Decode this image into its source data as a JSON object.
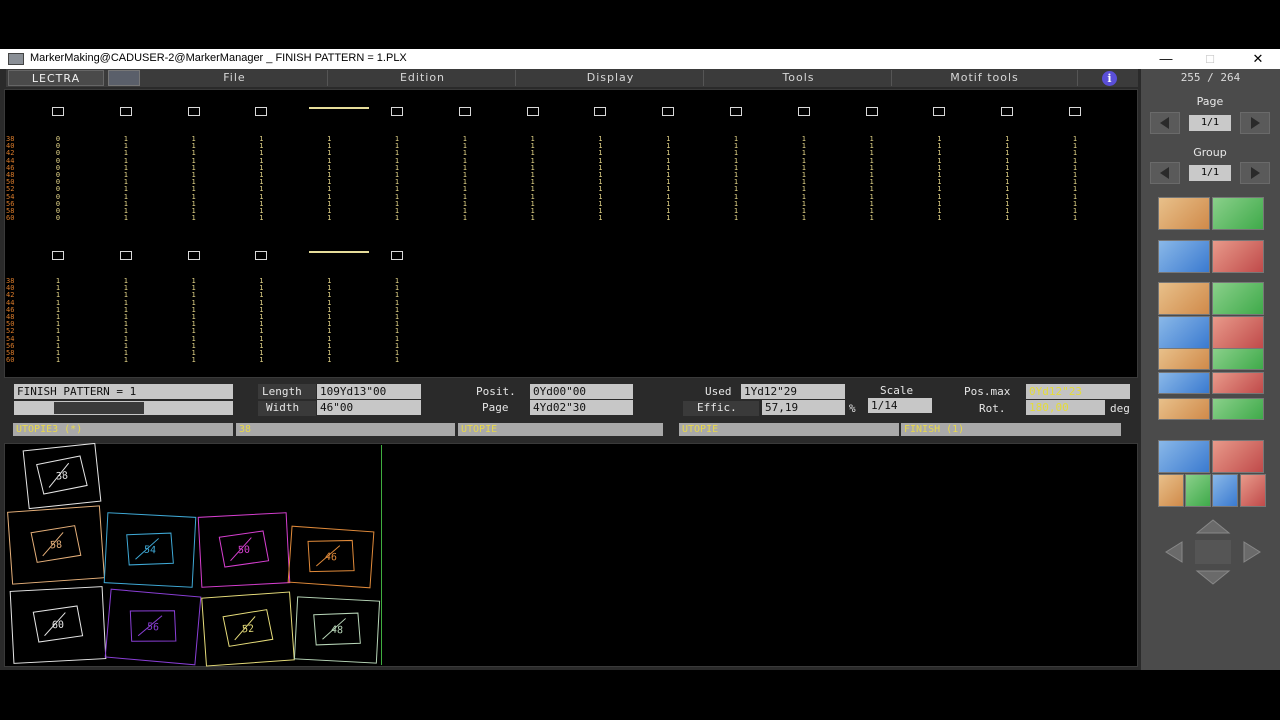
{
  "window": {
    "title": "MarkerMaking@CADUSER-2@MarkerManager _ FINISH PATTERN =  1.PLX",
    "minimize": "—",
    "maximize": "□",
    "close": "✕"
  },
  "menubar": {
    "logo": "LECTRA",
    "items": [
      "File",
      "Edition",
      "Display",
      "Tools",
      "Motif tools"
    ],
    "info": "i"
  },
  "right_panel": {
    "counter": "255 / 264",
    "page_label": "Page",
    "page_value": "1/1",
    "group_label": "Group",
    "group_value": "1/1",
    "tools": [
      "move-up-icon",
      "flip-icon",
      "place-icon",
      "combine-icon",
      "rotate-icon",
      "overlap-icon",
      "zoom-icon",
      "cut-icon",
      "block-icon",
      "band-icon",
      "stripe-icon",
      "piece-icon",
      "swap-icon",
      "marker-icon",
      "split-icon",
      "tile-icon",
      "draw-icon",
      "buffer-icon",
      "sort-icon",
      "group-icon"
    ]
  },
  "table": {
    "sizes": [
      "38",
      "40",
      "42",
      "44",
      "46",
      "48",
      "50",
      "52",
      "54",
      "56",
      "58",
      "60"
    ],
    "row1_columns": [
      [
        "0",
        "0",
        "0",
        "0",
        "0",
        "0",
        "0",
        "0",
        "0",
        "0",
        "0",
        "0"
      ],
      [
        "1",
        "1",
        "1",
        "1",
        "1",
        "1",
        "1",
        "1",
        "1",
        "1",
        "1",
        "1"
      ],
      [
        "1",
        "1",
        "1",
        "1",
        "1",
        "1",
        "1",
        "1",
        "1",
        "1",
        "1",
        "1"
      ],
      [
        "1",
        "1",
        "1",
        "1",
        "1",
        "1",
        "1",
        "1",
        "1",
        "1",
        "1",
        "1"
      ],
      [
        "1",
        "1",
        "1",
        "1",
        "1",
        "1",
        "1",
        "1",
        "1",
        "1",
        "1",
        "1"
      ],
      [
        "1",
        "1",
        "1",
        "1",
        "1",
        "1",
        "1",
        "1",
        "1",
        "1",
        "1",
        "1"
      ],
      [
        "1",
        "1",
        "1",
        "1",
        "1",
        "1",
        "1",
        "1",
        "1",
        "1",
        "1",
        "1"
      ],
      [
        "1",
        "1",
        "1",
        "1",
        "1",
        "1",
        "1",
        "1",
        "1",
        "1",
        "1",
        "1"
      ],
      [
        "1",
        "1",
        "1",
        "1",
        "1",
        "1",
        "1",
        "1",
        "1",
        "1",
        "1",
        "1"
      ],
      [
        "1",
        "1",
        "1",
        "1",
        "1",
        "1",
        "1",
        "1",
        "1",
        "1",
        "1",
        "1"
      ],
      [
        "1",
        "1",
        "1",
        "1",
        "1",
        "1",
        "1",
        "1",
        "1",
        "1",
        "1",
        "1"
      ],
      [
        "1",
        "1",
        "1",
        "1",
        "1",
        "1",
        "1",
        "1",
        "1",
        "1",
        "1",
        "1"
      ],
      [
        "1",
        "1",
        "1",
        "1",
        "1",
        "1",
        "1",
        "1",
        "1",
        "1",
        "1",
        "1"
      ],
      [
        "1",
        "1",
        "1",
        "1",
        "1",
        "1",
        "1",
        "1",
        "1",
        "1",
        "1",
        "1"
      ],
      [
        "1",
        "1",
        "1",
        "1",
        "1",
        "1",
        "1",
        "1",
        "1",
        "1",
        "1",
        "1"
      ],
      [
        "1",
        "1",
        "1",
        "1",
        "1",
        "1",
        "1",
        "1",
        "1",
        "1",
        "1",
        "1"
      ]
    ],
    "row2_columns": [
      [
        "1",
        "1",
        "1",
        "1",
        "1",
        "1",
        "1",
        "1",
        "1",
        "1",
        "1",
        "1"
      ],
      [
        "1",
        "1",
        "1",
        "1",
        "1",
        "1",
        "1",
        "1",
        "1",
        "1",
        "1",
        "1"
      ],
      [
        "1",
        "1",
        "1",
        "1",
        "1",
        "1",
        "1",
        "1",
        "1",
        "1",
        "1",
        "1"
      ],
      [
        "1",
        "1",
        "1",
        "1",
        "1",
        "1",
        "1",
        "1",
        "1",
        "1",
        "1",
        "1"
      ],
      [
        "1",
        "1",
        "1",
        "1",
        "1",
        "1",
        "1",
        "1",
        "1",
        "1",
        "1",
        "1"
      ],
      [
        "1",
        "1",
        "1",
        "1",
        "1",
        "1",
        "1",
        "1",
        "1",
        "1",
        "1",
        "1"
      ]
    ]
  },
  "status": {
    "pattern_label": "FINISH PATTERN =  1",
    "length_label": "Length",
    "length_value": "109Yd13\"00",
    "width_label": "Width",
    "width_value": "46\"00",
    "posit_label": "Posit.",
    "posit_value": "0Yd00\"00",
    "page_label": "Page",
    "page_value": "4Yd02\"30",
    "used_label": "Used",
    "used_value": "1Yd12\"29",
    "effic_label": "Effic.",
    "effic_value": "57,19",
    "percent": "%",
    "scale_label": "Scale",
    "scale_value": "1/14",
    "posmax_label": "Pos.max",
    "posmax_value": "0Yd12\"23",
    "rot_label": "Rot.",
    "rot_value": "180,00",
    "deg": "deg"
  },
  "info_row": [
    "UTOPIE3 (*)",
    "38",
    "UTOPIE",
    "UTOPIE",
    "FINISH (1)"
  ],
  "marker_pieces": [
    {
      "label": "38",
      "color": "#e6e6e6"
    },
    {
      "label": "58",
      "color": "#e6b07a"
    },
    {
      "label": "54",
      "color": "#3fa9d6"
    },
    {
      "label": "50",
      "color": "#d63fd0"
    },
    {
      "label": "46",
      "color": "#e08a3a"
    },
    {
      "label": "60",
      "color": "#e6e6e6"
    },
    {
      "label": "56",
      "color": "#8a3fd6"
    },
    {
      "label": "52",
      "color": "#e6dc7a"
    },
    {
      "label": "48",
      "color": "#b8d6b8"
    }
  ]
}
